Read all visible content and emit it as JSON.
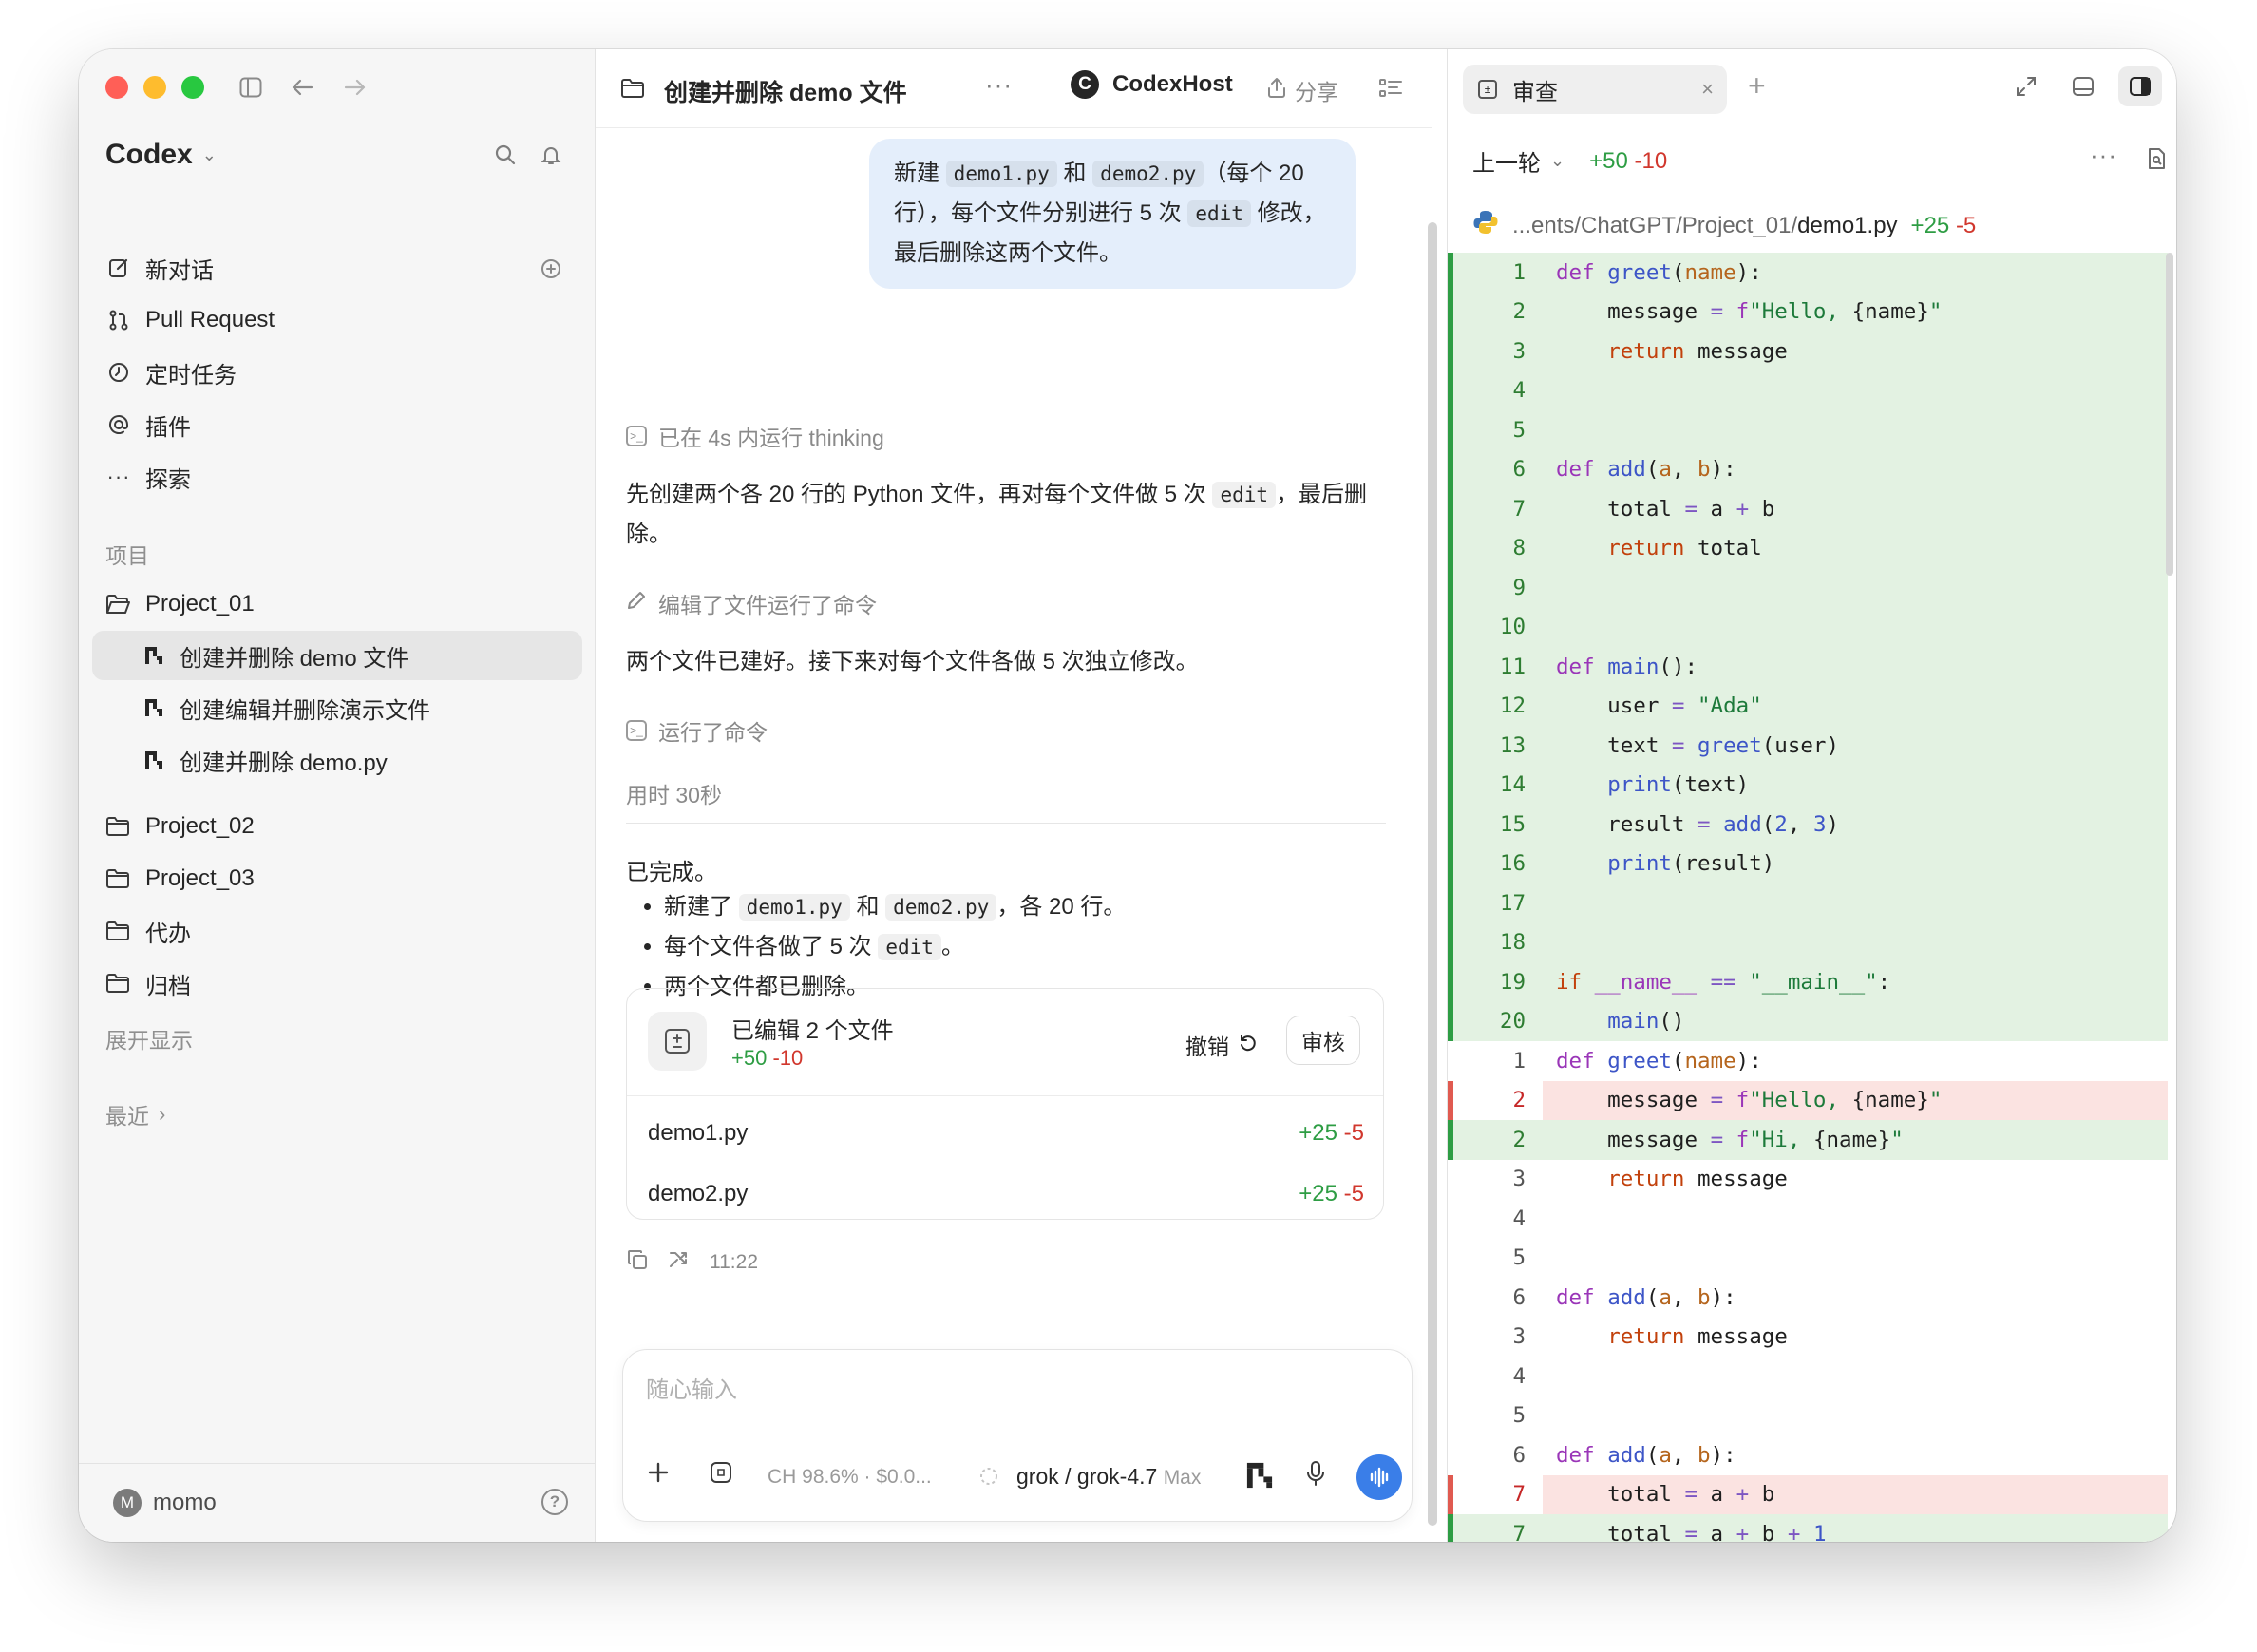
{
  "window": {
    "colors": {
      "close": "#ff5f57",
      "minimize": "#febc2e",
      "zoom": "#28c840",
      "accent_blue": "#3a7ee8",
      "add_green": "#2e9d44",
      "del_red": "#d1372d"
    }
  },
  "sidebar": {
    "app_name": "Codex",
    "nav": [
      {
        "label": "新对话",
        "icon": "edit-icon"
      },
      {
        "label": "Pull Request",
        "icon": "git-pull-request-icon"
      },
      {
        "label": "定时任务",
        "icon": "clock-icon"
      },
      {
        "label": "插件",
        "icon": "at-icon"
      },
      {
        "label": "探索",
        "icon": "ellipsis-icon"
      }
    ],
    "projects_label": "项目",
    "projects": [
      {
        "name": "Project_01",
        "threads": [
          "创建并删除 demo 文件",
          "创建编辑并删除演示文件",
          "创建并删除 demo.py"
        ]
      },
      {
        "name": "Project_02"
      },
      {
        "name": "Project_03"
      },
      {
        "name": "代办"
      },
      {
        "name": "归档"
      }
    ],
    "expand_label": "展开显示",
    "recent_label": "最近",
    "user": {
      "initial": "M",
      "name": "momo"
    },
    "help_glyph": "?"
  },
  "chat": {
    "title": "创建并删除 demo 文件",
    "more_glyph": "···",
    "host": {
      "logo_letter": "C",
      "name": "CodexHost"
    },
    "share_label": "分享",
    "user_message": {
      "p1": "新建 ",
      "c1": "demo1.py",
      "p2": " 和 ",
      "c2": "demo2.py",
      "p3": "（每个 20 行），每个文件分别进行 5 次 ",
      "c3": "edit",
      "p4": " 修改，最后删除这两个文件。"
    },
    "thinking": "已在 4s 内运行 thinking",
    "intro": {
      "p1": "先创建两个各 20 行的 Python 文件，再对每个文件做 5 次 ",
      "c1": "edit",
      "p2": "，最后删除。"
    },
    "step_edit": "编辑了文件运行了命令",
    "progress": "两个文件已建好。接下来对每个文件各做 5 次独立修改。",
    "step_cmd": "运行了命令",
    "elapsed": "用时 30秒",
    "done": "已完成。",
    "bullets": {
      "b1": {
        "p1": "新建了 ",
        "c1": "demo1.py",
        "p2": " 和 ",
        "c2": "demo2.py",
        "p3": "，各 20 行。"
      },
      "b2": {
        "p1": "每个文件各做了 5 次 ",
        "c1": "edit",
        "p2": "。"
      },
      "b3": "两个文件都已删除。"
    },
    "edited": {
      "title": "已编辑 2 个文件",
      "add": "+50",
      "del": "-10",
      "undo": "撤销",
      "review": "审核",
      "files": [
        {
          "name": "demo1.py",
          "add": "+25",
          "del": "-5"
        },
        {
          "name": "demo2.py",
          "add": "+25",
          "del": "-5"
        }
      ]
    },
    "time": "11:22",
    "composer": {
      "placeholder": "随心输入",
      "usage": "CH 98.6% · $0.0...",
      "model": "grok / grok-4.7",
      "model_tier": "Max"
    }
  },
  "review": {
    "tab_label": "审查",
    "tab_close": "×",
    "add_tab": "+",
    "round_label": "上一轮",
    "round_add": "+50",
    "round_del": "-10",
    "file": {
      "path_prefix": "...ents/ChatGPT/Project_01/",
      "name": "demo1.py",
      "add": "+25",
      "del": "-5"
    }
  }
}
